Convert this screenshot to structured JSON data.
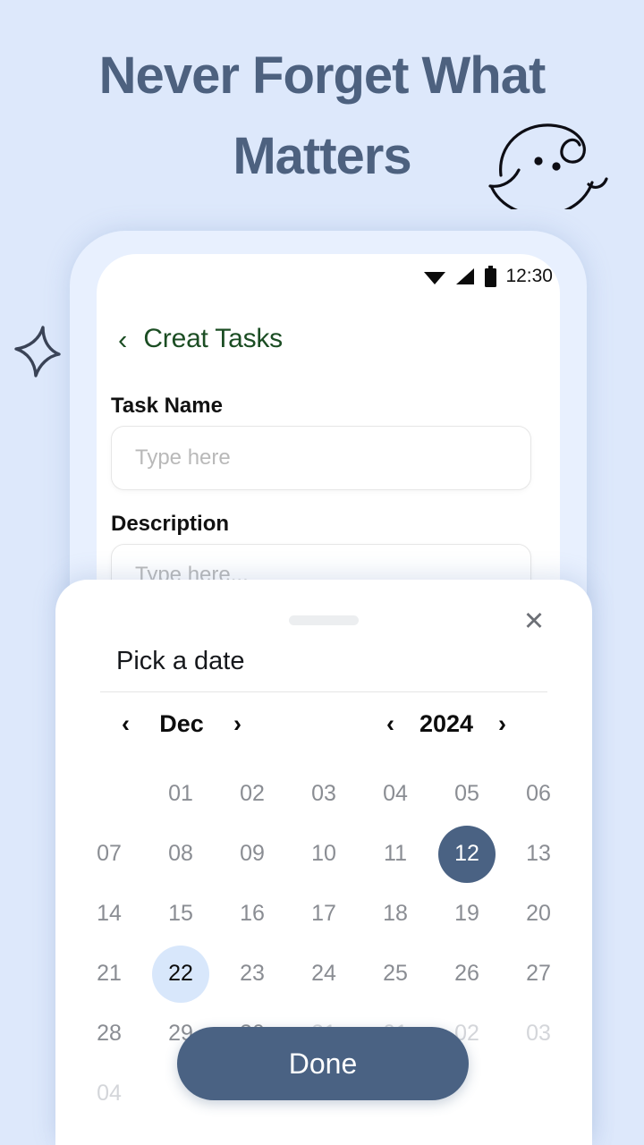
{
  "promo": {
    "headline_line1": "Never Forget What",
    "headline_line2": "Matters",
    "headline_color": "#4d617f",
    "background_color": "#dde8fb"
  },
  "phone": {
    "status_bar": {
      "time": "12:30",
      "icons": [
        "wifi-icon",
        "signal-icon",
        "battery-icon"
      ]
    },
    "app_bar": {
      "back_label": "‹",
      "title": "Creat Tasks",
      "title_color": "#1b4d23"
    },
    "form": {
      "task_name": {
        "label": "Task Name",
        "value": "",
        "placeholder": "Type here"
      },
      "description": {
        "label": "Description",
        "value": "",
        "placeholder": "Type here..."
      }
    }
  },
  "sheet": {
    "title": "Pick a date",
    "close_label": "✕",
    "month": {
      "prev": "‹",
      "value": "Dec",
      "next": "›"
    },
    "year": {
      "prev": "‹",
      "value": "2024",
      "next": "›"
    },
    "selected_day": "12",
    "today": "22",
    "accent_color": "#4a6283",
    "today_color": "#d8e7fb",
    "done_label": "Done",
    "weeks": [
      [
        {
          "d": "",
          "s": "empty"
        },
        {
          "d": "01",
          "s": "normal"
        },
        {
          "d": "02",
          "s": "normal"
        },
        {
          "d": "03",
          "s": "normal"
        },
        {
          "d": "04",
          "s": "normal"
        },
        {
          "d": "05",
          "s": "normal"
        },
        {
          "d": "06",
          "s": "normal"
        }
      ],
      [
        {
          "d": "07",
          "s": "normal"
        },
        {
          "d": "08",
          "s": "normal"
        },
        {
          "d": "09",
          "s": "normal"
        },
        {
          "d": "10",
          "s": "normal"
        },
        {
          "d": "11",
          "s": "normal"
        },
        {
          "d": "12",
          "s": "selected"
        },
        {
          "d": "13",
          "s": "normal"
        }
      ],
      [
        {
          "d": "14",
          "s": "normal"
        },
        {
          "d": "15",
          "s": "normal"
        },
        {
          "d": "16",
          "s": "normal"
        },
        {
          "d": "17",
          "s": "normal"
        },
        {
          "d": "18",
          "s": "normal"
        },
        {
          "d": "19",
          "s": "normal"
        },
        {
          "d": "20",
          "s": "normal"
        }
      ],
      [
        {
          "d": "21",
          "s": "normal"
        },
        {
          "d": "22",
          "s": "today"
        },
        {
          "d": "23",
          "s": "normal"
        },
        {
          "d": "24",
          "s": "normal"
        },
        {
          "d": "25",
          "s": "normal"
        },
        {
          "d": "26",
          "s": "normal"
        },
        {
          "d": "27",
          "s": "normal"
        }
      ],
      [
        {
          "d": "28",
          "s": "normal"
        },
        {
          "d": "29",
          "s": "normal"
        },
        {
          "d": "30",
          "s": "normal"
        },
        {
          "d": "31",
          "s": "muted"
        },
        {
          "d": "01",
          "s": "muted"
        },
        {
          "d": "02",
          "s": "muted"
        },
        {
          "d": "03",
          "s": "muted"
        }
      ],
      [
        {
          "d": "04",
          "s": "muted"
        },
        {
          "d": "",
          "s": "empty"
        },
        {
          "d": "",
          "s": "empty"
        },
        {
          "d": "",
          "s": "empty"
        },
        {
          "d": "",
          "s": "empty"
        },
        {
          "d": "",
          "s": "empty"
        },
        {
          "d": "",
          "s": "empty"
        }
      ]
    ]
  },
  "decorations": {
    "smiley": "smiley-doodle",
    "sparkle": "sparkle-star"
  }
}
